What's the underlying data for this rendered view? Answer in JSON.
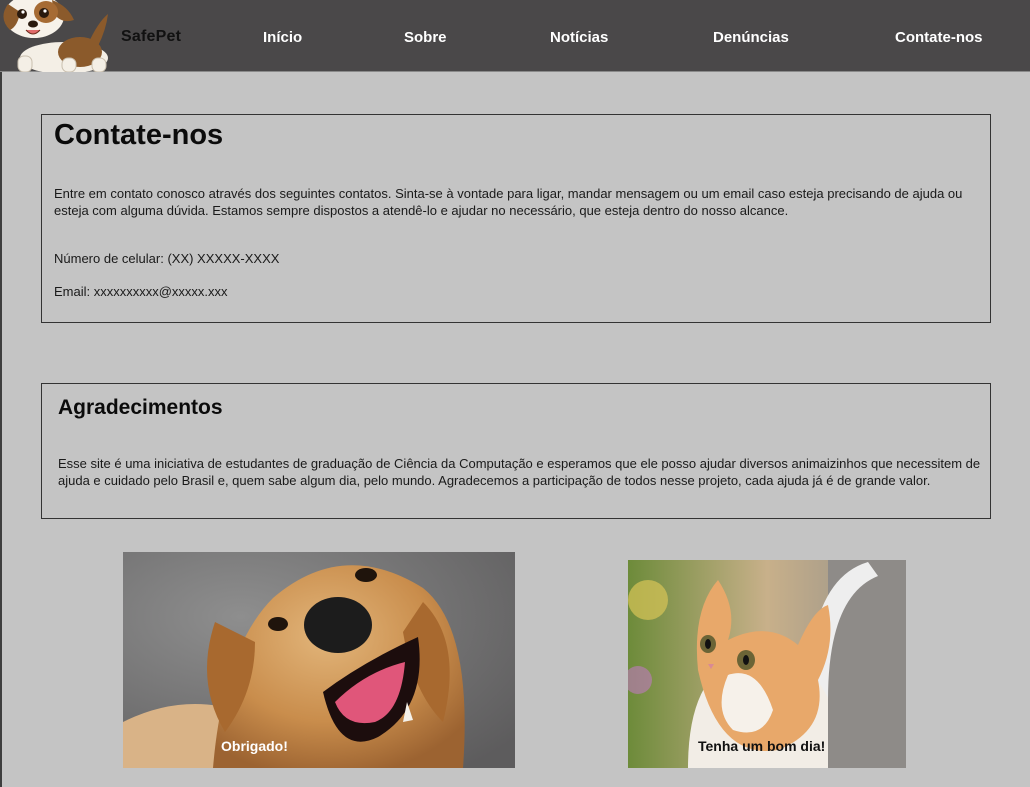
{
  "header": {
    "brand": "SafePet",
    "nav": {
      "home": "Início",
      "about": "Sobre",
      "news": "Notícias",
      "reports": "Denúncias",
      "contact": "Contate-nos"
    }
  },
  "contact": {
    "title": "Contate-nos",
    "intro": "Entre em contato conosco através dos seguintes contatos. Sinta-se à vontade para ligar, mandar mensagem ou um email caso esteja precisando de ajuda ou esteja com alguma dúvida. Estamos sempre dispostos a atendê-lo e ajudar no necessário, que esteja dentro do nosso alcance.",
    "phone": "Número de celular: (XX) XXXXX-XXXX",
    "email": "Email: xxxxxxxxxx@xxxxx.xxx"
  },
  "thanks": {
    "title": "Agradecimentos",
    "text": "Esse site é uma iniciativa de estudantes de graduação de Ciência da Computação e esperamos que ele posso ajudar diversos animaizinhos que necessitem de ajuda e cuidado pelo Brasil e, quem sabe algum dia, pelo mundo. Agradecemos a participação de todos nesse projeto, cada ajuda já é de grande valor."
  },
  "photos": {
    "dog_caption": "Obrigado!",
    "cat_caption": "Tenha um bom dia!"
  }
}
